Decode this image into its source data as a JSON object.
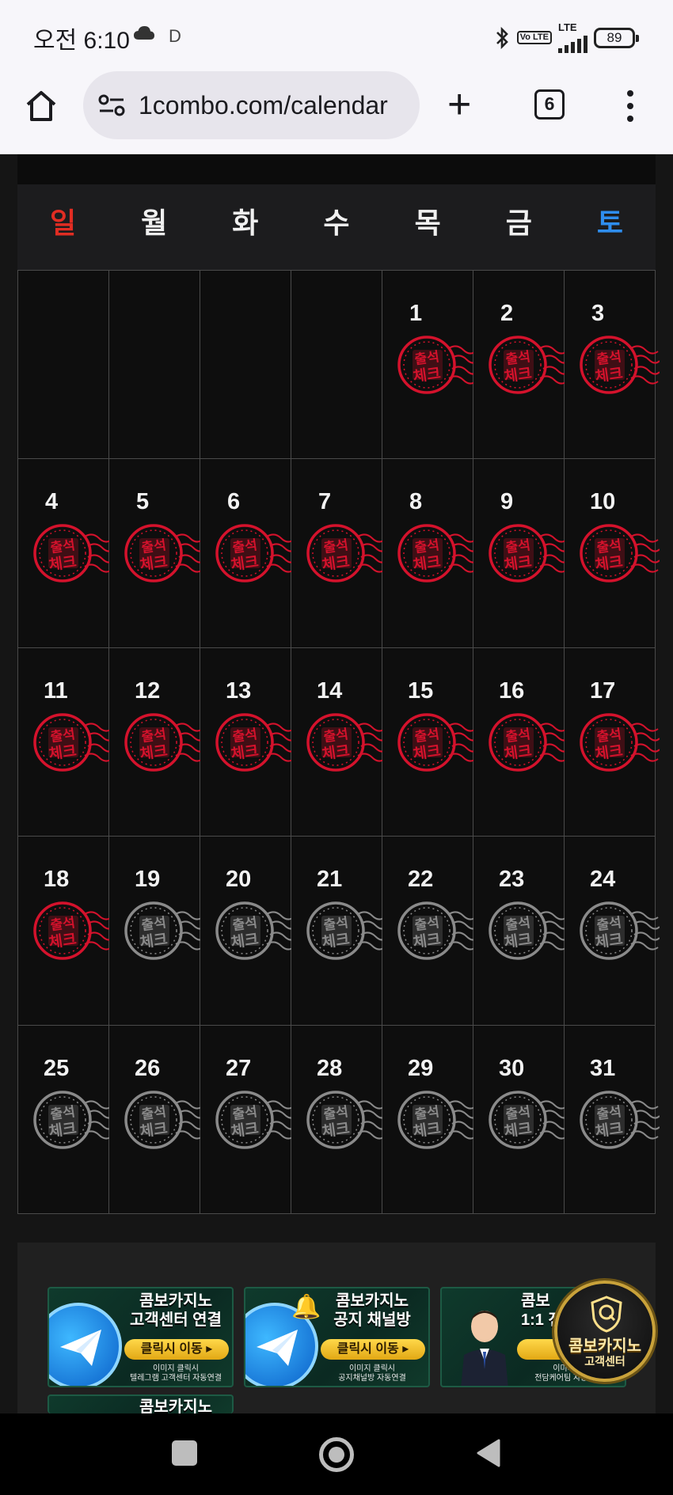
{
  "status_bar": {
    "time": "오전 6:10",
    "indicator_d": "D",
    "volte": "Vo LTE",
    "lte": "LTE",
    "battery": "89"
  },
  "browser": {
    "url": "1combo.com/calendar",
    "tab_count": "6"
  },
  "calendar": {
    "weekdays": [
      "일",
      "월",
      "화",
      "수",
      "목",
      "금",
      "토"
    ],
    "stamp_text_top": "출석",
    "stamp_text_bottom": "체크",
    "first_weekday_index": 4,
    "days_in_month": 31,
    "checked_through_day": 18,
    "stamp_colors": {
      "checked": "#d4122c",
      "unchecked": "#8a8a8a"
    }
  },
  "banners": [
    {
      "title_line1": "콤보카지노",
      "title_line2": "고객센터 연결",
      "cta": "클릭시 이동 ▸",
      "sub1": "이미지 클릭시",
      "sub2": "텔레그램 고객센터 자동연결"
    },
    {
      "title_line1": "콤보카지노",
      "title_line2": "공지 채널방",
      "cta": "클릭시 이동 ▸",
      "sub1": "이미지 클릭시",
      "sub2": "공지채널방 자동연결"
    },
    {
      "title_line1": "콤보",
      "title_line2": "1:1 전",
      "cta": "클릭",
      "sub1": "이미지 클",
      "sub2": "전담케어팀 자동연결"
    },
    {
      "title_line1": "콤보카지노",
      "title_line2": "",
      "cta": "",
      "sub1": "",
      "sub2": ""
    }
  ],
  "cs_badge": {
    "line1": "콤보카지노",
    "line2": "고객센터"
  }
}
